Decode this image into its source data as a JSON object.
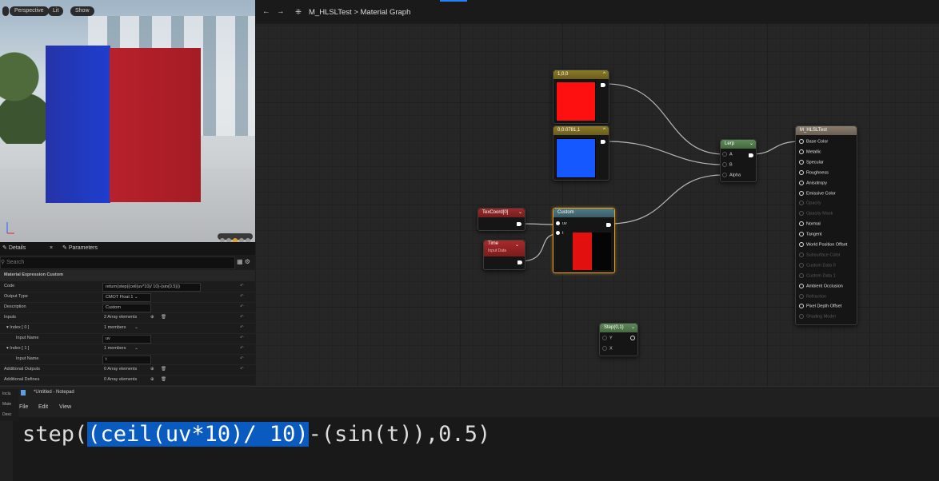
{
  "viewport": {
    "buttons": [
      "Perspective",
      "Lit",
      "Show"
    ]
  },
  "details": {
    "tab_details": "Details",
    "tab_parameters": "Parameters",
    "search_placeholder": "Search",
    "section_title": "Material Expression Custom",
    "rows": [
      {
        "label": "Code",
        "value": "return(step((ceil(uv*10)/ 10)-(sin(0.5)))"
      },
      {
        "label": "Output Type",
        "value": "CMOT Float 1"
      },
      {
        "label": "Description",
        "value": "Custom"
      },
      {
        "label": "Inputs",
        "value": "2 Array elements"
      },
      {
        "label": "Index [ 0 ]",
        "value": "1 members"
      },
      {
        "label": "Input Name",
        "value": "uv"
      },
      {
        "label": "Index [ 1 ]",
        "value": "1 members"
      },
      {
        "label": "Input Name",
        "value": "t"
      },
      {
        "label": "Additional Outputs",
        "value": "0 Array elements"
      },
      {
        "label": "Additional Defines",
        "value": "0 Array elements"
      }
    ]
  },
  "graph": {
    "breadcrumb_asset": "M_HLSLTest",
    "breadcrumb_page": "Material Graph",
    "nodes": {
      "const_red": "1,0,0",
      "const_blue": "0,0.0781,1",
      "lerp": {
        "title": "Lerp",
        "pins": [
          "A",
          "B",
          "Alpha"
        ]
      },
      "texcoord": "TexCoord[0]",
      "time": {
        "title": "Time",
        "subtitle": "Input Data"
      },
      "custom": {
        "title": "Custom",
        "pins": [
          "uv",
          "t"
        ]
      },
      "step": {
        "title": "Step(0,1)",
        "pins": [
          "Y",
          "X"
        ]
      },
      "material": {
        "title": "M_HLSLTest",
        "pins": [
          {
            "label": "Base Color",
            "enabled": true
          },
          {
            "label": "Metallic",
            "enabled": true
          },
          {
            "label": "Specular",
            "enabled": true
          },
          {
            "label": "Roughness",
            "enabled": true
          },
          {
            "label": "Anisotropy",
            "enabled": true
          },
          {
            "label": "Emissive Color",
            "enabled": true
          },
          {
            "label": "Opacity",
            "enabled": false
          },
          {
            "label": "Opacity Mask",
            "enabled": false
          },
          {
            "label": "Normal",
            "enabled": true
          },
          {
            "label": "Tangent",
            "enabled": true
          },
          {
            "label": "World Position Offset",
            "enabled": true
          },
          {
            "label": "Subsurface Color",
            "enabled": false
          },
          {
            "label": "Custom Data 0",
            "enabled": false
          },
          {
            "label": "Custom Data 1",
            "enabled": false
          },
          {
            "label": "Ambient Occlusion",
            "enabled": true
          },
          {
            "label": "Refraction",
            "enabled": false
          },
          {
            "label": "Pixel Depth Offset",
            "enabled": true
          },
          {
            "label": "Shading Model",
            "enabled": false
          }
        ]
      }
    }
  },
  "notepad": {
    "title": "*Untitled - Notepad",
    "menu": [
      "File",
      "Edit",
      "View"
    ],
    "code_before": "step(",
    "code_selected": "(ceil(uv*10)/ 10)",
    "code_after": "-(sin(t)),0.5)"
  }
}
